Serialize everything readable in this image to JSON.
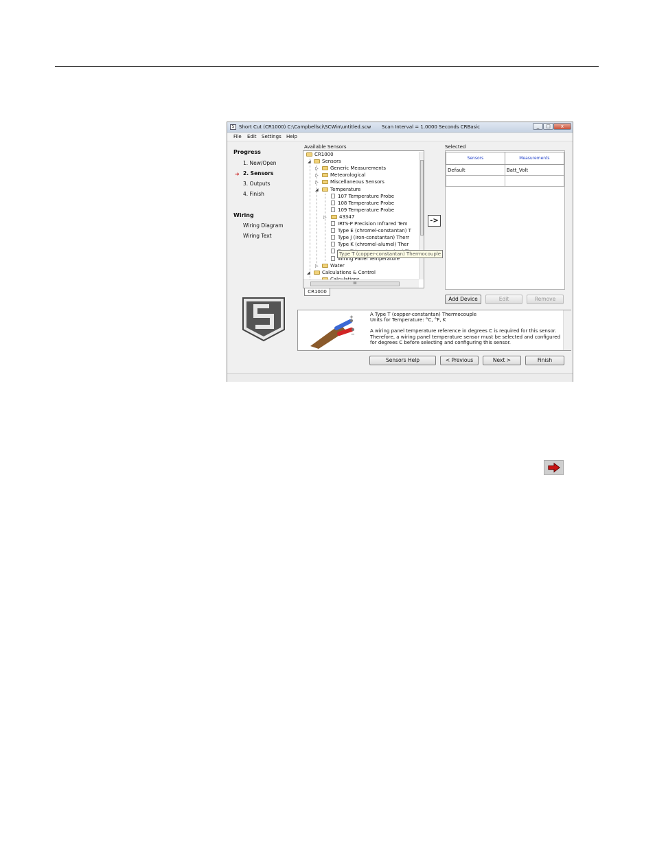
{
  "window": {
    "title": "Short Cut (CR1000) C:\\Campbellsci\\SCWin\\untitled.scw",
    "scan_info": "Scan Interval = 1.0000 Seconds CRBasic",
    "controls": [
      "_",
      "□",
      "x"
    ]
  },
  "menu": [
    "File",
    "Edit",
    "Settings",
    "Help"
  ],
  "sidebar": {
    "progress_heading": "Progress",
    "progress_items": [
      "1. New/Open",
      "2. Sensors",
      "3. Outputs",
      "4. Finish"
    ],
    "current_marker": "➔",
    "wiring_heading": "Wiring",
    "wiring_items": [
      "Wiring Diagram",
      "Wiring Text"
    ]
  },
  "available": {
    "label": "Available Sensors",
    "tree": [
      {
        "text": "CR1000",
        "kind": "folder",
        "exp": ""
      },
      {
        "text": "Sensors",
        "kind": "folder",
        "exp": "◢"
      },
      {
        "text": "Generic Measurements",
        "kind": "folder",
        "exp": "▷"
      },
      {
        "text": "Meteorological",
        "kind": "folder",
        "exp": "▷"
      },
      {
        "text": "Miscellaneous Sensors",
        "kind": "folder",
        "exp": "▷"
      },
      {
        "text": "Temperature",
        "kind": "folder",
        "exp": "◢"
      },
      {
        "text": "107 Temperature Probe",
        "kind": "doc",
        "exp": ""
      },
      {
        "text": "108 Temperature Probe",
        "kind": "doc",
        "exp": ""
      },
      {
        "text": "109 Temperature Probe",
        "kind": "doc",
        "exp": ""
      },
      {
        "text": "43347",
        "kind": "folder",
        "exp": "▷"
      },
      {
        "text": "IRTS-P Precision Infrared Tem",
        "kind": "doc",
        "exp": ""
      },
      {
        "text": "Type E (chromel-constantan) T",
        "kind": "doc",
        "exp": ""
      },
      {
        "text": "Type J (iron-constantan) Therr",
        "kind": "doc",
        "exp": ""
      },
      {
        "text": "Type K (chromel-alumel) Ther",
        "kind": "doc",
        "exp": ""
      },
      {
        "text": "Type T (copper-constantan) Thermocouple",
        "kind": "doc",
        "exp": ""
      },
      {
        "text": "Wiring Panel Temperature",
        "kind": "doc",
        "exp": ""
      },
      {
        "text": "Water",
        "kind": "folder",
        "exp": "▷"
      },
      {
        "text": "Calculations & Control",
        "kind": "folder",
        "exp": "◢"
      },
      {
        "text": "Calculations",
        "kind": "folder",
        "exp": ""
      }
    ],
    "hscroll_label": "III",
    "tab": "CR1000"
  },
  "move_button": "->",
  "selected": {
    "label": "Selected",
    "headers": [
      "Sensors",
      "Measurements"
    ],
    "rows": [
      [
        "Default",
        "Batt_Volt"
      ],
      [
        "",
        ""
      ]
    ]
  },
  "device_buttons": {
    "add": "Add Device",
    "edit": "Edit",
    "remove": "Remove"
  },
  "description": {
    "line1": "A Type T (copper-constantan) Thermocouple",
    "line2": "Units for Temperature: °C, °F, K",
    "para": "A wiring panel temperature reference in degrees C is required for this sensor. Therefore, a wiring panel temperature sensor must be selected and configured for degrees C before selecting and configuring this sensor.",
    "plus": "+",
    "minus": "−"
  },
  "nav_buttons": {
    "help": "Sensors Help",
    "previous": "< Previous",
    "next": "Next >",
    "finish": "Finish"
  },
  "colors": {
    "marker_red": "#c81414",
    "header_blue": "#1f3fc8",
    "wire_red": "#d12525",
    "wire_blue": "#3b68d4",
    "cable_brown": "#8a5a2b"
  }
}
